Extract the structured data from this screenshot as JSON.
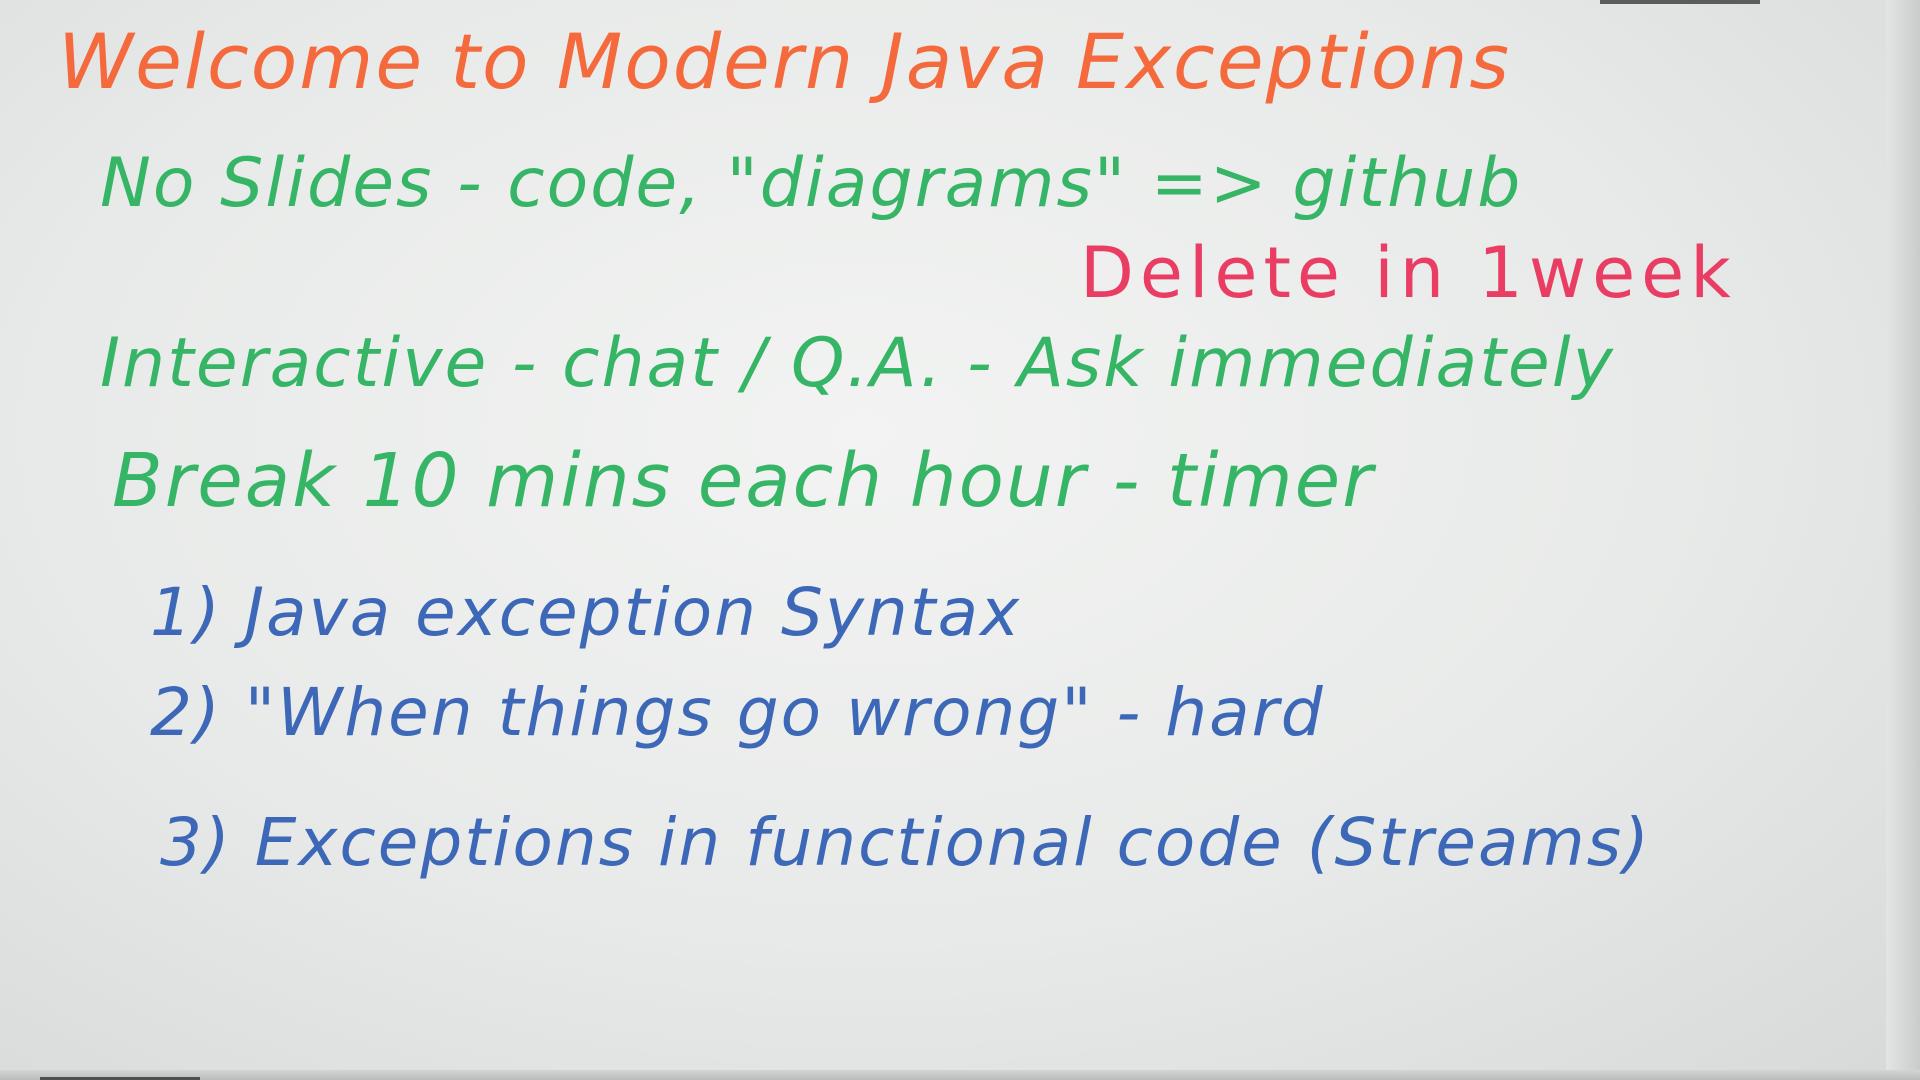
{
  "whiteboard": {
    "title": "Welcome to Modern Java Exceptions",
    "lines": [
      "No Slides - code, \"diagrams\" => github",
      "Delete in 1week",
      "Interactive - chat / Q.A. - Ask immediately",
      "Break 10 mins each hour - timer"
    ],
    "agenda": [
      "1) Java exception Syntax",
      "2) \"When things go wrong\" - hard",
      "3) Exceptions in functional code (Streams)"
    ]
  },
  "colors": {
    "title": "#f46a3c",
    "notes": "#36b566",
    "highlight": "#ea3d63",
    "agenda": "#3d68b8",
    "board": "#eceeed"
  }
}
